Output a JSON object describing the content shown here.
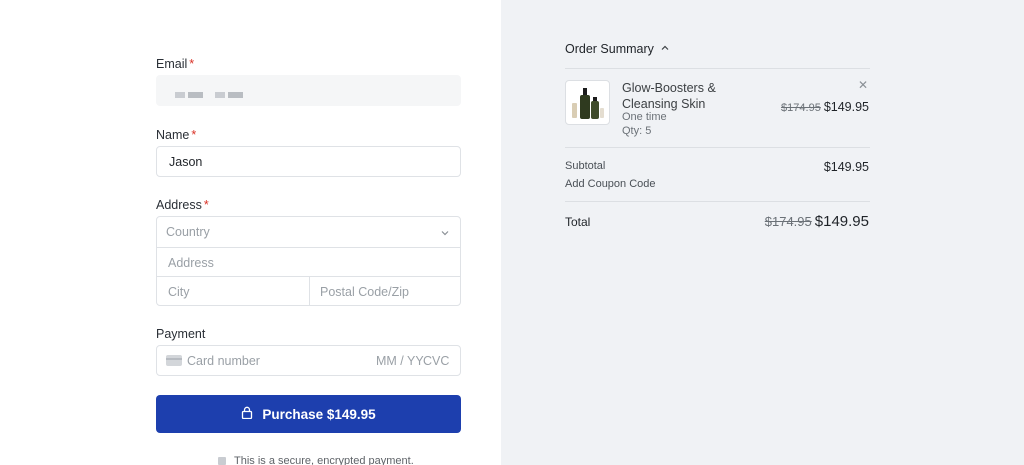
{
  "form": {
    "email_label": "Email",
    "name_label": "Name",
    "name_value": "Jason",
    "address_label": "Address",
    "required_mark": "*",
    "country_placeholder": "Country",
    "address_placeholder": "Address",
    "city_placeholder": "City",
    "postal_placeholder": "Postal Code/Zip",
    "payment_label": "Payment",
    "card_placeholder": "Card number",
    "expiry_placeholder": "MM / YY",
    "cvc_placeholder": "CVC",
    "purchase_label": "Purchase $149.95",
    "secure_note": "This is a secure, encrypted payment.",
    "accent_color": "#1d3fae"
  },
  "summary": {
    "title": "Order Summary",
    "item": {
      "name": "Glow-Boosters & Cleansing Skin",
      "frequency": "One time",
      "qty": "Qty: 5",
      "original_price": "$174.95",
      "price": "$149.95"
    },
    "subtotal_label": "Subtotal",
    "subtotal_value": "$149.95",
    "coupon_label": "Add Coupon Code",
    "total_label": "Total",
    "total_original": "$174.95",
    "total_value": "$149.95"
  }
}
